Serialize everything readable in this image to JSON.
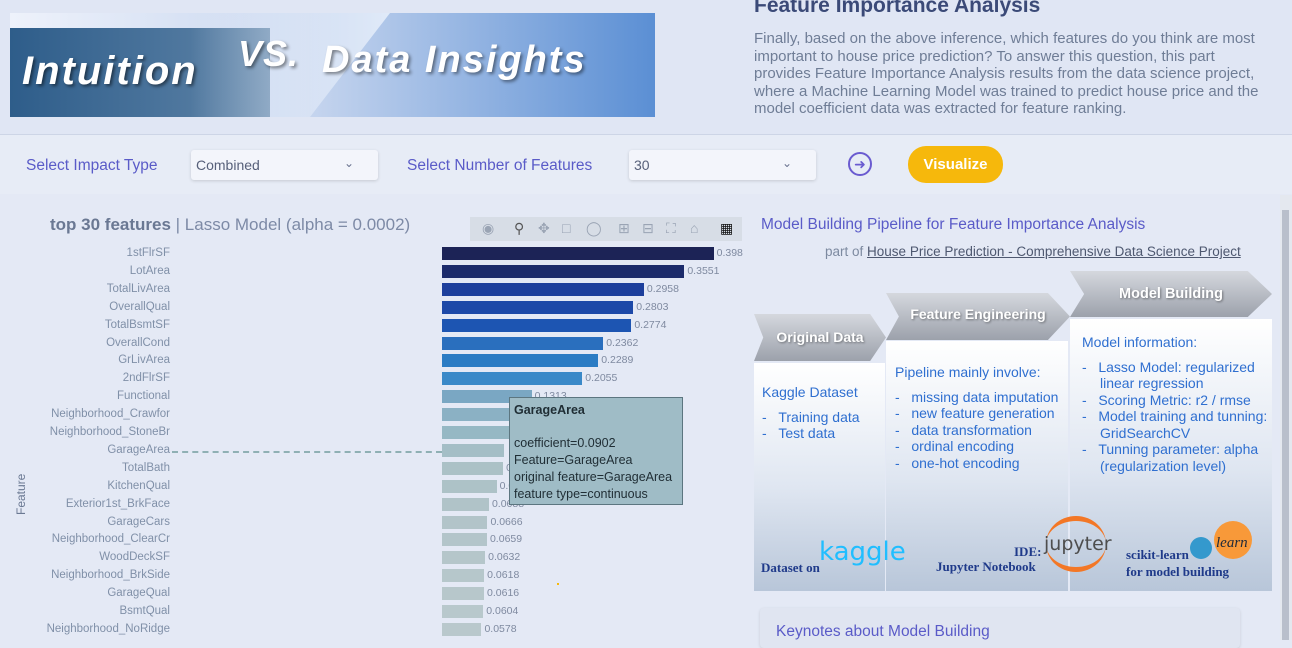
{
  "header": {
    "banner_word1": "Intuition",
    "banner_word2": "VS.",
    "banner_word3": "Data Insights",
    "section_title": "Feature Importance Analysis",
    "section_text": "Finally, based on the above inference, which features do you think are most important to house price prediction? To answer this question, this part provides Feature Importance Analysis results from the data science project, where a Machine Learning Model was trained to predict house price and the model coefficient data was extracted for feature ranking."
  },
  "controls": {
    "impact_label": "Select Impact Type",
    "impact_value": "Combined",
    "number_label": "Select Number of Features",
    "number_value": "30",
    "visualize_label": "Visualize",
    "go_icon": "arrow-right-circle-icon"
  },
  "chart_title_bold": "top 30 features",
  "chart_title_rest": "| Lasso Model (alpha = 0.0002)",
  "chart_data": {
    "type": "bar",
    "orientation": "horizontal",
    "ylabel": "Feature",
    "categories": [
      "1stFlrSF",
      "LotArea",
      "TotalLivArea",
      "OverallQual",
      "TotalBsmtSF",
      "OverallCond",
      "GrLivArea",
      "2ndFlrSF",
      "Functional",
      "Neighborhood_Crawfor",
      "Neighborhood_StoneBr",
      "GarageArea",
      "TotalBath",
      "KitchenQual",
      "Exterior1st_BrkFace",
      "GarageCars",
      "Neighborhood_ClearCr",
      "WoodDeckSF",
      "Neighborhood_BrkSide",
      "GarageQual",
      "BsmtQual",
      "Neighborhood_NoRidge"
    ],
    "values": [
      0.398,
      0.3551,
      0.2958,
      0.2803,
      0.2774,
      0.2362,
      0.2289,
      0.2055,
      0.1313,
      0.12,
      0.11,
      0.0902,
      0.0895,
      0.08,
      0.0688,
      0.0666,
      0.0659,
      0.0632,
      0.0618,
      0.0616,
      0.0604,
      0.0578
    ],
    "value_labels": [
      "0.398",
      "0.3551",
      "0.2958",
      "0.2803",
      "0.2774",
      "0.2362",
      "0.2289",
      "0.2055",
      "0.1313",
      "",
      "",
      "",
      "0",
      "0.0",
      "0.0688",
      "0.0666",
      "0.0659",
      "0.0632",
      "0.0618",
      "0.0616",
      "0.0604",
      "0.0578"
    ],
    "colors": [
      "#1c2356",
      "#1c2b6b",
      "#1d3f9c",
      "#1d49a8",
      "#1d55b2",
      "#2a6fbe",
      "#2b7cc4",
      "#3a89c8",
      "#7aa7c3",
      "#8bb1c4",
      "#96b8c4",
      "#a4bec6",
      "#abc1c6",
      "#adc2c7",
      "#b0c3c8",
      "#b2c4c9",
      "#b3c5ca",
      "#b5c6ca",
      "#b6c7cb",
      "#b7c7cb",
      "#b8c8cc",
      "#b9c8cc"
    ],
    "xlim": [
      0,
      0.4
    ]
  },
  "tooltip": {
    "title": "GarageArea",
    "line1": "coefficient=0.0902",
    "line2": "Feature=GarageArea",
    "line3": "original feature=GarageArea",
    "line4": "feature type=continuous"
  },
  "modebar": [
    "camera-icon",
    "zoom-icon",
    "pan-icon",
    "box-select-icon",
    "lasso-select-icon",
    "zoom-in-icon",
    "zoom-out-icon",
    "autoscale-icon",
    "home-icon",
    "plotly-logo-icon"
  ],
  "pipeline": {
    "title": "Model Building Pipeline for Feature Importance Analysis",
    "sub_prefix": "part of",
    "sub_link": "House Price Prediction - Comprehensive Data Science Project",
    "step1": "Original Data",
    "step2": "Feature Engineering",
    "step3": "Model Building",
    "col1_head": "Kaggle Dataset",
    "col1_items": [
      "Training data",
      "Test data"
    ],
    "col2_head": "Pipeline mainly involve:",
    "col2_items": [
      "missing data imputation",
      "new feature generation",
      "data transformation",
      "ordinal encoding",
      "one-hot encoding"
    ],
    "col3_head": "Model information:",
    "col3_items": [
      "Lasso Model: regularized linear regression",
      "Scoring Metric: r2 / rmse",
      "Model training and tunning: GridSearchCV",
      "Tunning parameter: alpha (regularization level)"
    ],
    "brand1_a": "Dataset on",
    "brand1_b": "kaggle",
    "brand2_a": "IDE:",
    "brand2_b": "jupyter",
    "brand2_c": "Jupyter Notebook",
    "brand3_a": "scikit-learn",
    "brand3_b": "learn",
    "brand3_c": "for model building"
  },
  "keynote": "Keynotes about Model Building"
}
